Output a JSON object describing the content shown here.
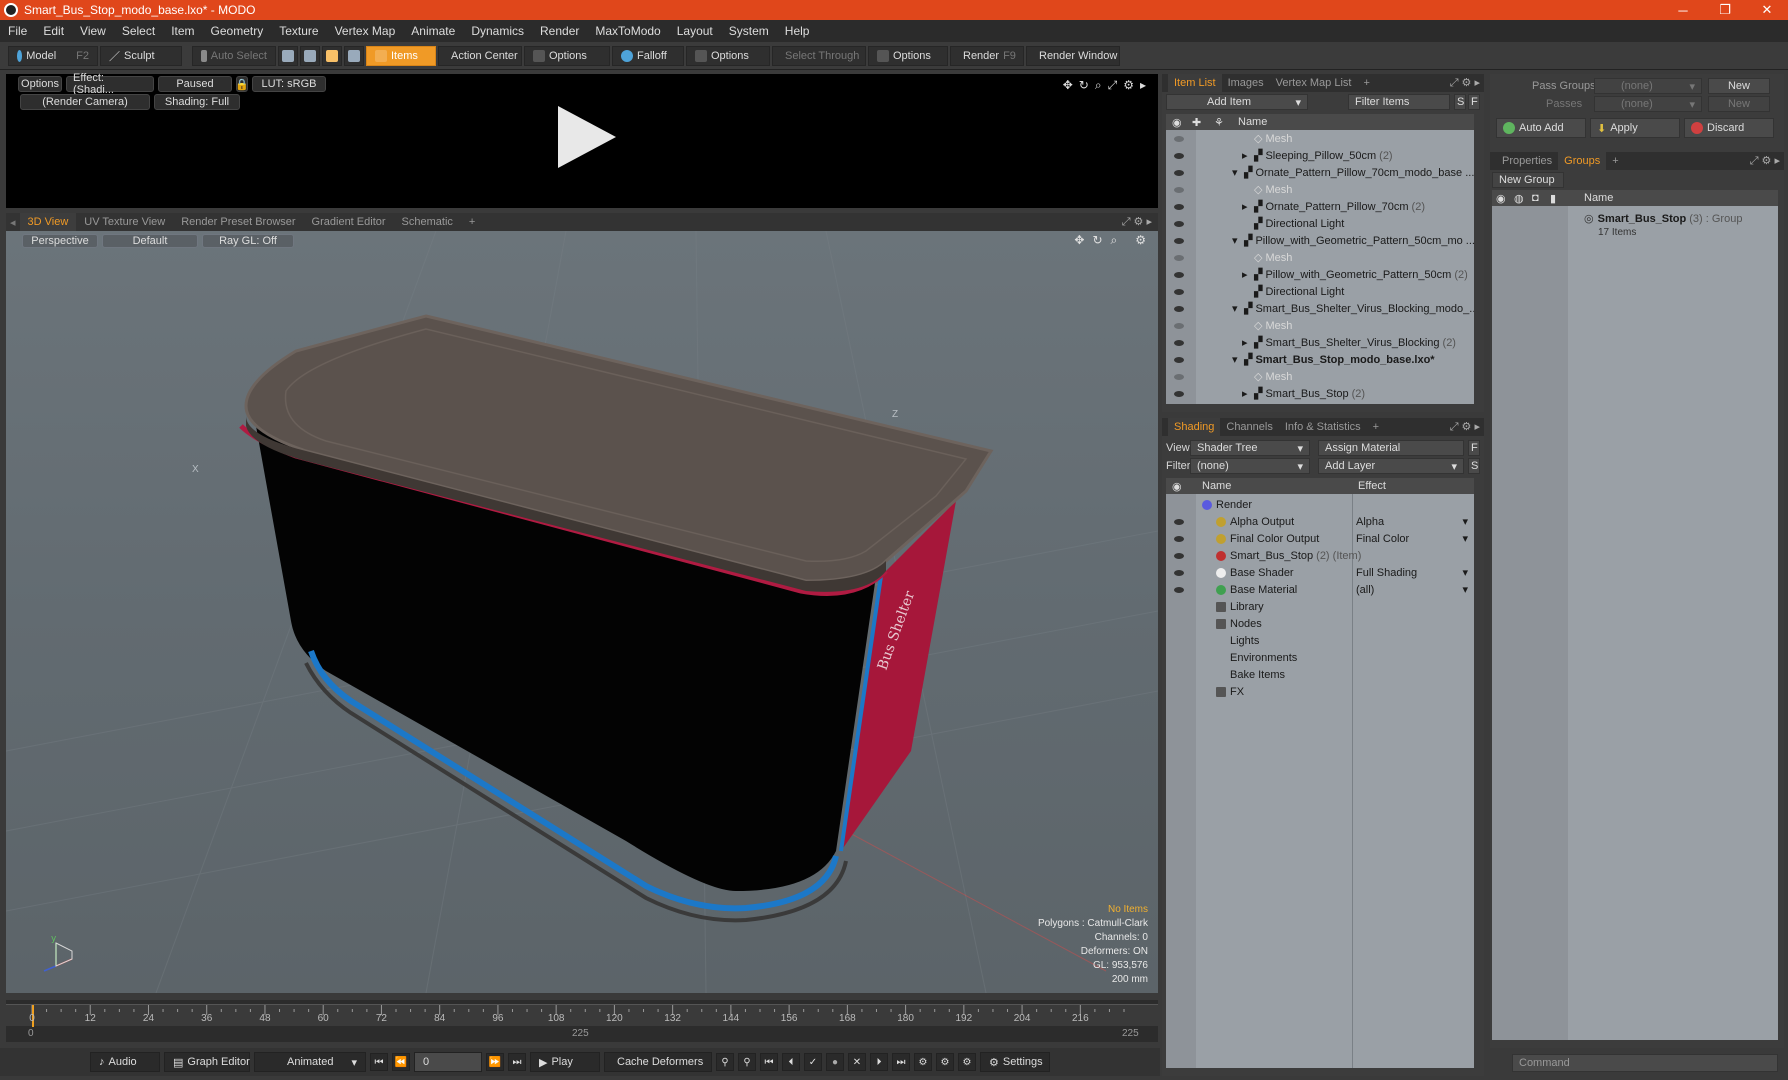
{
  "window": {
    "title": "Smart_Bus_Stop_modo_base.lxo* - MODO",
    "minimize": "─",
    "maximize": "❐",
    "close": "✕"
  },
  "menu": [
    "File",
    "Edit",
    "View",
    "Select",
    "Item",
    "Geometry",
    "Texture",
    "Vertex Map",
    "Animate",
    "Dynamics",
    "Render",
    "MaxToModo",
    "Layout",
    "System",
    "Help"
  ],
  "toolbar": {
    "model": "Model",
    "model_key": "F2",
    "sculpt": "Sculpt",
    "auto_select": "Auto Select",
    "items": "Items",
    "action_center": "Action Center",
    "options1": "Options",
    "falloff": "Falloff",
    "options2": "Options",
    "select_through": "Select Through",
    "options3": "Options",
    "render": "Render",
    "render_key": "F9",
    "render_window": "Render Window"
  },
  "render_view": {
    "options": "Options",
    "effect": "Effect: (Shadi...",
    "paused": "Paused",
    "lut": "LUT: sRGB",
    "camera": "(Render Camera)",
    "shading": "Shading: Full"
  },
  "view_tabs": [
    "3D View",
    "UV Texture View",
    "Render Preset Browser",
    "Gradient Editor",
    "Schematic",
    "+"
  ],
  "viewport": {
    "perspective": "Perspective",
    "default": "Default",
    "raygl": "Ray GL: Off",
    "axis_x": "X",
    "axis_z": "Z",
    "stats": {
      "no_items": "No Items",
      "polygons": "Polygons : Catmull-Clark",
      "channels": "Channels: 0",
      "deformers": "Deformers: ON",
      "gl": "GL: 953,576",
      "scale": "200 mm"
    }
  },
  "timeline": {
    "labels": [
      "0",
      "12",
      "24",
      "36",
      "48",
      "60",
      "72",
      "84",
      "96",
      "108",
      "120",
      "132",
      "144",
      "156",
      "168",
      "180",
      "192",
      "204",
      "216"
    ],
    "start": "0",
    "mid": "225",
    "end": "225"
  },
  "transport": {
    "audio": "Audio",
    "graph_editor": "Graph Editor",
    "animated": "Animated",
    "frame": "0",
    "play": "Play",
    "cache_deformers": "Cache Deformers",
    "settings": "Settings"
  },
  "item_list": {
    "tabs": [
      "Item List",
      "Images",
      "Vertex Map List",
      "+"
    ],
    "add_item": "Add Item",
    "filter_items": "Filter Items",
    "s": "S",
    "f": "F",
    "header": "Name",
    "rows": [
      {
        "name": "Mesh",
        "count": "",
        "indent": 1,
        "dim": true,
        "bold": false,
        "arrow": ""
      },
      {
        "name": "Sleeping_Pillow_50cm",
        "count": "(2)",
        "indent": 1,
        "dim": false,
        "bold": false,
        "arrow": "▸"
      },
      {
        "name": "Ornate_Pattern_Pillow_70cm_modo_base ...",
        "count": "",
        "indent": 0,
        "dim": false,
        "bold": false,
        "arrow": "▾"
      },
      {
        "name": "Mesh",
        "count": "",
        "indent": 1,
        "dim": true,
        "bold": false,
        "arrow": ""
      },
      {
        "name": "Ornate_Pattern_Pillow_70cm",
        "count": "(2)",
        "indent": 1,
        "dim": false,
        "bold": false,
        "arrow": "▸"
      },
      {
        "name": "Directional Light",
        "count": "",
        "indent": 1,
        "dim": false,
        "bold": false,
        "arrow": ""
      },
      {
        "name": "Pillow_with_Geometric_Pattern_50cm_mo ...",
        "count": "",
        "indent": 0,
        "dim": false,
        "bold": false,
        "arrow": "▾"
      },
      {
        "name": "Mesh",
        "count": "",
        "indent": 1,
        "dim": true,
        "bold": false,
        "arrow": ""
      },
      {
        "name": "Pillow_with_Geometric_Pattern_50cm",
        "count": "(2)",
        "indent": 1,
        "dim": false,
        "bold": false,
        "arrow": "▸"
      },
      {
        "name": "Directional Light",
        "count": "",
        "indent": 1,
        "dim": false,
        "bold": false,
        "arrow": ""
      },
      {
        "name": "Smart_Bus_Shelter_Virus_Blocking_modo_...",
        "count": "",
        "indent": 0,
        "dim": false,
        "bold": false,
        "arrow": "▾"
      },
      {
        "name": "Mesh",
        "count": "",
        "indent": 1,
        "dim": true,
        "bold": false,
        "arrow": ""
      },
      {
        "name": "Smart_Bus_Shelter_Virus_Blocking",
        "count": "(2)",
        "indent": 1,
        "dim": false,
        "bold": false,
        "arrow": "▸"
      },
      {
        "name": "Smart_Bus_Stop_modo_base.lxo*",
        "count": "",
        "indent": 0,
        "dim": false,
        "bold": true,
        "arrow": "▾"
      },
      {
        "name": "Mesh",
        "count": "",
        "indent": 1,
        "dim": true,
        "bold": false,
        "arrow": ""
      },
      {
        "name": "Smart_Bus_Stop",
        "count": "(2)",
        "indent": 1,
        "dim": false,
        "bold": false,
        "arrow": "▸"
      }
    ]
  },
  "shading": {
    "tabs": [
      "Shading",
      "Channels",
      "Info & Statistics",
      "+"
    ],
    "view_label": "View",
    "view_value": "Shader Tree",
    "assign_material": "Assign Material",
    "f": "F",
    "filter_label": "Filter",
    "filter_value": "(none)",
    "add_layer": "Add Layer",
    "s": "S",
    "col_name": "Name",
    "col_effect": "Effect",
    "rows": [
      {
        "name": "Render",
        "count": "",
        "effect": "",
        "indent": 0,
        "eye": false
      },
      {
        "name": "Alpha Output",
        "count": "",
        "effect": "Alpha",
        "indent": 1,
        "eye": true
      },
      {
        "name": "Final Color Output",
        "count": "",
        "effect": "Final Color",
        "indent": 1,
        "eye": true
      },
      {
        "name": "Smart_Bus_Stop",
        "count": "(2) (Item)",
        "effect": "",
        "indent": 1,
        "eye": true
      },
      {
        "name": "Base Shader",
        "count": "",
        "effect": "Full Shading",
        "indent": 1,
        "eye": true
      },
      {
        "name": "Base Material",
        "count": "",
        "effect": "(all)",
        "indent": 1,
        "eye": true
      },
      {
        "name": "Library",
        "count": "",
        "effect": "",
        "indent": 1,
        "eye": false
      },
      {
        "name": "Nodes",
        "count": "",
        "effect": "",
        "indent": 1,
        "eye": false
      },
      {
        "name": "Lights",
        "count": "",
        "effect": "",
        "indent": 1,
        "eye": false
      },
      {
        "name": "Environments",
        "count": "",
        "effect": "",
        "indent": 1,
        "eye": false
      },
      {
        "name": "Bake Items",
        "count": "",
        "effect": "",
        "indent": 1,
        "eye": false
      },
      {
        "name": "FX",
        "count": "",
        "effect": "",
        "indent": 1,
        "eye": false
      }
    ]
  },
  "groups": {
    "pass_groups_label": "Pass Groups",
    "pass_groups_value": "(none)",
    "new1": "New",
    "passes_label": "Passes",
    "passes_value": "(none)",
    "new2": "New",
    "auto_add": "Auto Add",
    "apply": "Apply",
    "discard": "Discard",
    "tabs": [
      "Properties",
      "Groups",
      "+"
    ],
    "new_group": "New Group",
    "col_name": "Name",
    "group_name": "Smart_Bus_Stop",
    "group_count": "(3) : Group",
    "group_items": "17 Items"
  },
  "command": {
    "placeholder": "Command"
  }
}
